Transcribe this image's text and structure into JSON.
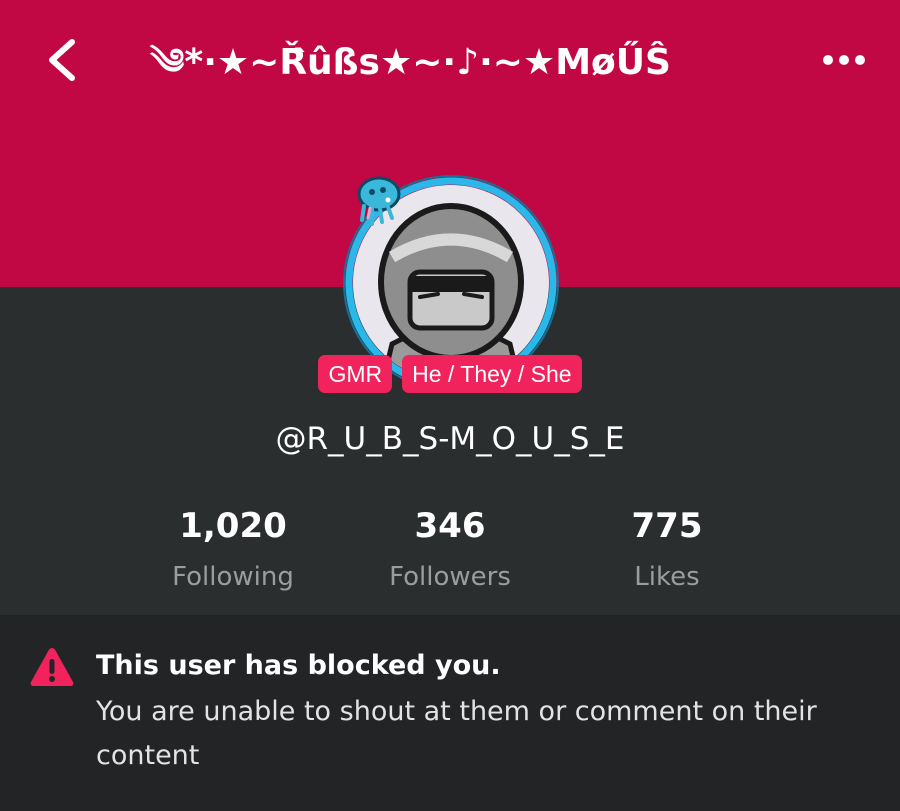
{
  "header": {
    "title": "༄*·★~Ř̂ûßs★~·♪·~★MøŰŜ",
    "back_icon": "chevron-left-icon",
    "more_icon": "more-horizontal-icon"
  },
  "profile": {
    "badges": [
      {
        "label": "GMR"
      },
      {
        "label": "He / They / She"
      }
    ],
    "username": "@R_U_B_S-M_O_U_S_E",
    "avatar_icon": "avatar-hooded-figure"
  },
  "stats": [
    {
      "value": "1,020",
      "label": "Following"
    },
    {
      "value": "346",
      "label": "Followers"
    },
    {
      "value": "775",
      "label": "Likes"
    }
  ],
  "notice": {
    "icon": "warning-icon",
    "title": "This user has blocked you.",
    "message": "You are unable to shout at them or comment on their content"
  },
  "colors": {
    "banner": "#c20745",
    "accent": "#f0235d",
    "body_bg": "#2b2e2f",
    "notice_bg": "#222425",
    "avatar_ring": "#2ab7ea"
  }
}
